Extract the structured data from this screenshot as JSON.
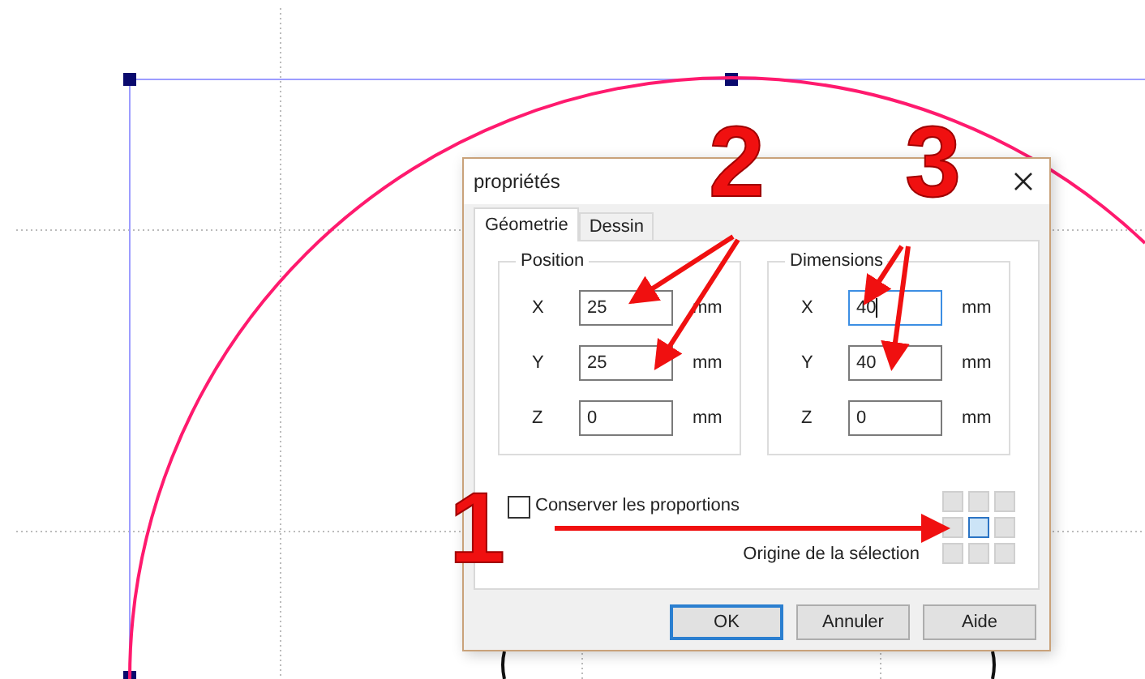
{
  "dialog": {
    "title": "propriétés",
    "tabs": [
      {
        "label": "Géometrie",
        "selected": true
      },
      {
        "label": "Dessin",
        "selected": false
      }
    ],
    "groups": [
      {
        "title": "Position",
        "rows": [
          {
            "axis": "X",
            "value": "25",
            "unit": "mm",
            "focused": false
          },
          {
            "axis": "Y",
            "value": "25",
            "unit": "mm",
            "focused": false
          },
          {
            "axis": "Z",
            "value": "0",
            "unit": "mm",
            "focused": false
          }
        ]
      },
      {
        "title": "Dimensions",
        "rows": [
          {
            "axis": "X",
            "value": "40",
            "unit": "mm",
            "focused": true
          },
          {
            "axis": "Y",
            "value": "40",
            "unit": "mm",
            "focused": false
          },
          {
            "axis": "Z",
            "value": "0",
            "unit": "mm",
            "focused": false
          }
        ]
      }
    ],
    "keep_proportions": {
      "label": "Conserver les proportions",
      "checked": false
    },
    "origin": {
      "label": "Origine de la sélection",
      "cells": [
        {
          "selected": false
        },
        {
          "selected": false
        },
        {
          "selected": false
        },
        {
          "selected": false
        },
        {
          "selected": true
        },
        {
          "selected": false
        },
        {
          "selected": false
        },
        {
          "selected": false
        },
        {
          "selected": false
        }
      ]
    },
    "buttons": [
      {
        "label": "OK",
        "default": true
      },
      {
        "label": "Annuler",
        "default": false
      },
      {
        "label": "Aide",
        "default": false
      }
    ]
  },
  "annotations": [
    {
      "label": "2"
    },
    {
      "label": "3"
    },
    {
      "label": "1"
    }
  ]
}
